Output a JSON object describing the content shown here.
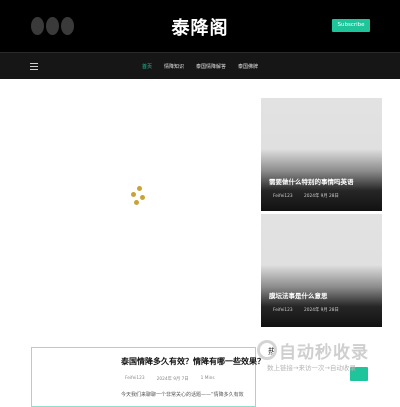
{
  "header": {
    "site_title": "泰降阁",
    "subscribe_label": "Subscribe",
    "social_icons": [
      "social-icon-1",
      "social-icon-2",
      "social-icon-3"
    ]
  },
  "nav": {
    "menu_icon": "menu-icon",
    "items": [
      {
        "label": "首页",
        "active": true
      },
      {
        "label": "情降知识",
        "active": false
      },
      {
        "label": "泰国情降解答",
        "active": false
      },
      {
        "label": "泰国佛牌",
        "active": false
      }
    ]
  },
  "featured": [
    {
      "title": "需要做什么特别的事情吗英语",
      "author": "Feifei123",
      "date": "2024年 9月 28日"
    },
    {
      "title": "膜坛法事是什么意思",
      "author": "Feifei123",
      "date": "2024年 9月 28日"
    }
  ],
  "post": {
    "title": "泰国情降多久有效？情降有哪一些效果？",
    "author": "Feifei123",
    "date": "2024年 9月 7日",
    "read_time": "1 Mins",
    "excerpt": "今天我们来聊聊一个非常关心的话题——“情降多久有效"
  },
  "sidebar": {
    "label": "热"
  },
  "watermark": {
    "text": "自动秒收录",
    "subtext": "数上链接→来访一次→自动收录"
  },
  "colors": {
    "accent": "#1ec49a",
    "header_bg": "#000000",
    "nav_bg": "#161616",
    "loader": "#c9a23a"
  }
}
